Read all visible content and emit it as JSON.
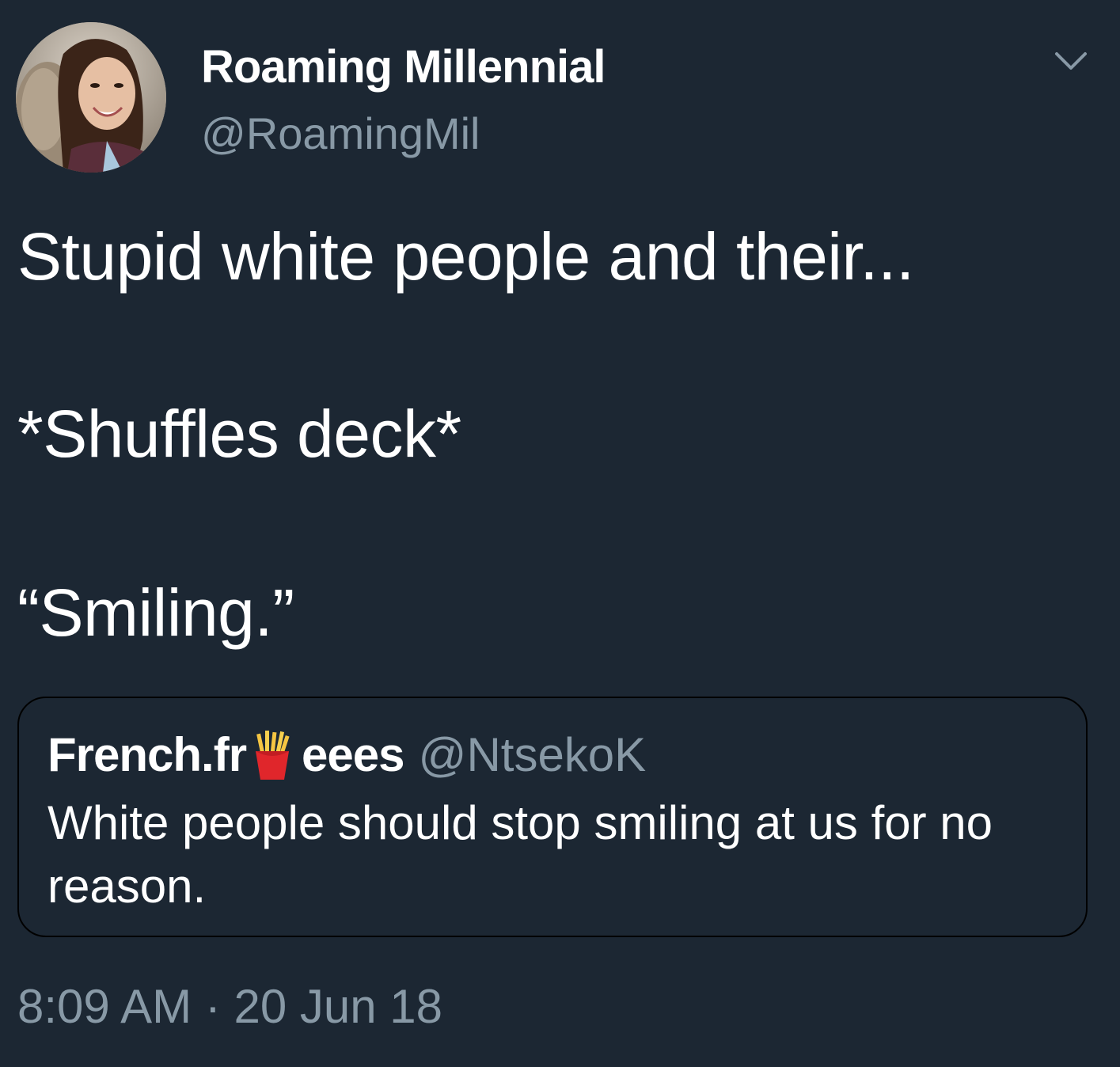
{
  "author": {
    "display_name": "Roaming Millennial",
    "handle": "@RoamingMil",
    "avatar_icon": "profile-photo"
  },
  "menu": {
    "icon": "chevron-down-icon"
  },
  "tweet": {
    "line1": "Stupid white people and their...",
    "line2": "*Shuffles deck*",
    "line3": "“Smiling.”"
  },
  "quoted_tweet": {
    "name_part1": "French.fr",
    "name_emoji": "french-fries-icon",
    "name_part2": "eees",
    "handle": "@NtsekoK",
    "text": "White people should stop smiling at us for no reason."
  },
  "timestamp": {
    "time": "8:09 AM",
    "separator": "·",
    "date": "20 Jun 18"
  },
  "colors": {
    "background": "#1c2733",
    "primary_text": "#ffffff",
    "secondary_text": "#8899a6",
    "card_border": "#000000"
  }
}
